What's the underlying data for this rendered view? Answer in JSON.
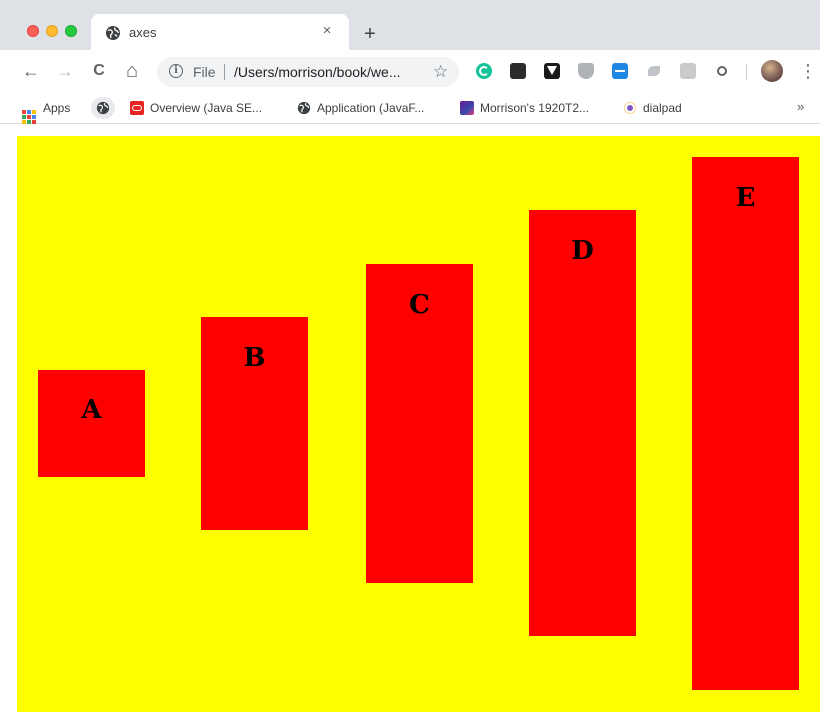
{
  "browser": {
    "tab": {
      "title": "axes",
      "close_glyph": "×",
      "favicon": "globe-icon"
    },
    "new_tab_glyph": "+",
    "toolbar": {
      "back_glyph": "←",
      "forward_glyph": "→",
      "reload_glyph": "C",
      "home_glyph": "⌂",
      "info_glyph": "i",
      "scheme_label": "File",
      "url": "/Users/morrison/book/we...",
      "star_glyph": "☆",
      "menu_glyph": "⋮",
      "extensions": [
        "grammarly-icon",
        "extension-dark-icon",
        "vimeo-icon",
        "shield-icon",
        "connector-icon",
        "feather-icon",
        "es-icon",
        "circle-icon"
      ]
    },
    "bookmarks": {
      "apps_label": "Apps",
      "items": [
        {
          "label": "",
          "icon": "globe-icon"
        },
        {
          "label": "Overview (Java SE...",
          "icon": "oracle-icon"
        },
        {
          "label": "Application (JavaF...",
          "icon": "globe-icon"
        },
        {
          "label": "Morrison's 1920T2...",
          "icon": "photo-icon"
        },
        {
          "label": "dialpad",
          "icon": "dialpad-icon"
        }
      ],
      "overflow_glyph": "»"
    }
  },
  "page": {
    "background": "#ffff00",
    "bar_color": "#ff0000",
    "label_color": "#000000",
    "labels": [
      "A",
      "B",
      "C",
      "D",
      "E"
    ]
  }
}
